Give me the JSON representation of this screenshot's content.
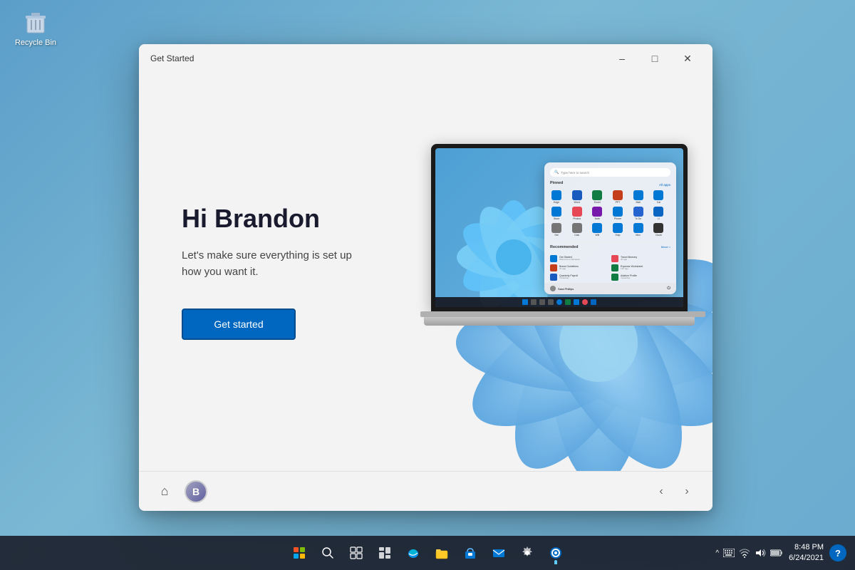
{
  "desktop": {
    "background_color": "#6aabcd"
  },
  "recycle_bin": {
    "label": "Recycle Bin"
  },
  "window": {
    "title": "Get Started",
    "minimize_label": "–",
    "maximize_label": "□",
    "close_label": "✕"
  },
  "left_panel": {
    "greeting": "Hi Brandon",
    "subtitle": "Let's make sure everything is set up how you want it.",
    "cta_button": "Get started"
  },
  "laptop_screen": {
    "search_placeholder": "Type here to search",
    "pinned_label": "Pinned",
    "all_apps_label": "All apps",
    "recommended_label": "Recommended",
    "move_label": "Move >",
    "apps": [
      {
        "name": "Edge",
        "color": "#0078d4"
      },
      {
        "name": "Word",
        "color": "#185abd"
      },
      {
        "name": "Excel",
        "color": "#107c41"
      },
      {
        "name": "PowerPoint",
        "color": "#c43e1c"
      },
      {
        "name": "Mail",
        "color": "#0078d4"
      },
      {
        "name": "Calendar",
        "color": "#0078d4"
      },
      {
        "name": "Store",
        "color": "#0078d4"
      },
      {
        "name": "Photos",
        "color": "#e74856"
      },
      {
        "name": "OneNote",
        "color": "#7719aa"
      },
      {
        "name": "Your Phone",
        "color": "#0078d4"
      },
      {
        "name": "To Do",
        "color": "#2564cf"
      },
      {
        "name": "LinkedIn",
        "color": "#0a66c2"
      },
      {
        "name": "Settings",
        "color": "#757575"
      },
      {
        "name": "Calculator",
        "color": "#757575"
      },
      {
        "name": "Whiteboard",
        "color": "#0078d4"
      },
      {
        "name": "Snipping",
        "color": "#0078d4"
      },
      {
        "name": "Movies",
        "color": "#0078d4"
      },
      {
        "name": "Clock",
        "color": "#333"
      }
    ],
    "recommended_items": [
      {
        "name": "Get Started",
        "sub": "Welcome to Windows",
        "color": "#0078d4"
      },
      {
        "name": "Travel Itinerary",
        "sub": "2h ago",
        "color": "#e74856"
      },
      {
        "name": "Brand Guidelines",
        "sub": "2h ago",
        "color": "#c43e1c"
      },
      {
        "name": "Expense Worksheet",
        "sub": "12h ago",
        "color": "#107c41"
      },
      {
        "name": "Quarterly Payroll",
        "sub": "Yesterday at 4:25 PM",
        "color": "#185abd"
      },
      {
        "name": "Adatum Company Profile",
        "sub": "Yesterday at 1:15 PM",
        "color": "#107c41"
      }
    ],
    "user_name": "Sara Phillips"
  },
  "footer": {
    "home_icon": "⌂",
    "avatar_initials": "B",
    "prev_icon": "‹",
    "next_icon": "›"
  },
  "taskbar": {
    "icons": [
      {
        "name": "start-button",
        "symbol": "⊞"
      },
      {
        "name": "search-button",
        "symbol": "⌕"
      },
      {
        "name": "task-view",
        "symbol": "❑"
      },
      {
        "name": "widgets",
        "symbol": "⊟"
      },
      {
        "name": "edge",
        "symbol": "e"
      },
      {
        "name": "file-explorer",
        "symbol": "📁"
      },
      {
        "name": "microsoft-store",
        "symbol": "⊠"
      },
      {
        "name": "mail",
        "symbol": "✉"
      },
      {
        "name": "settings",
        "symbol": "⚙"
      },
      {
        "name": "get-started",
        "symbol": "⊕"
      }
    ],
    "clock_time": "8:48 PM",
    "clock_date": "6/24/2021",
    "system_tray": {
      "chevron": "^",
      "keyboard": "⌨",
      "wifi": "WiFi",
      "volume": "🔊",
      "battery": "🔋"
    }
  }
}
